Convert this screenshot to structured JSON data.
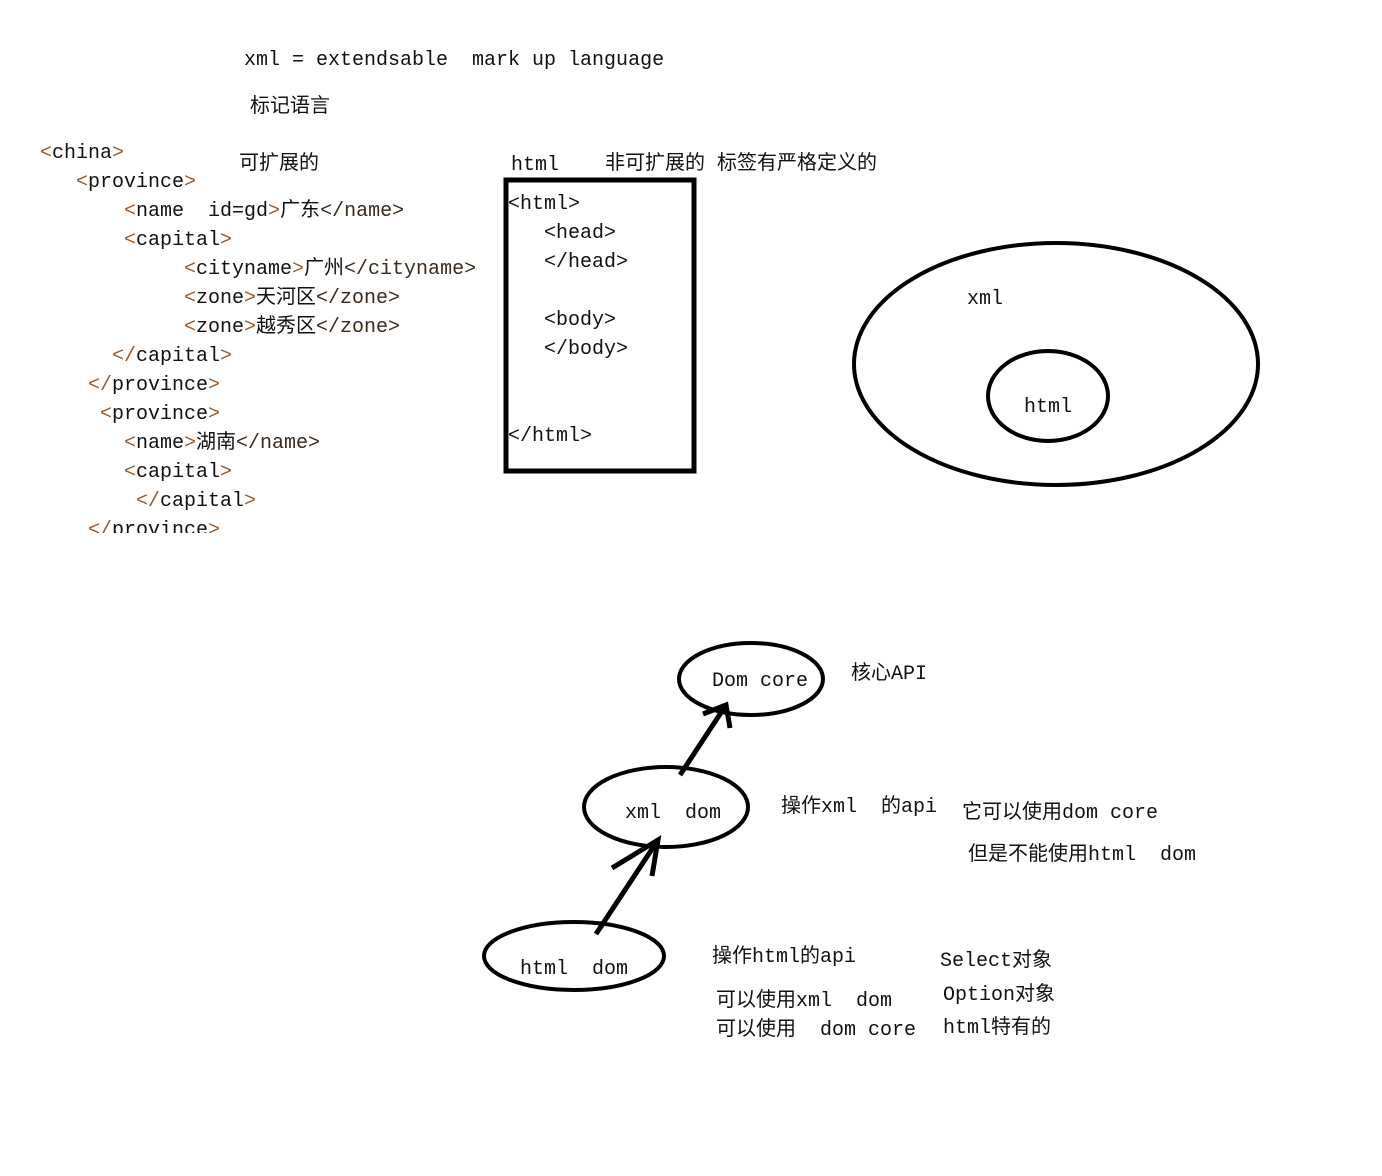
{
  "header": {
    "definition": "xml = extendsable  mark up language",
    "subtitle": "标记语言",
    "extensible": "可扩展的"
  },
  "xml_code": [
    {
      "indent": 0,
      "open": "<",
      "text": "china",
      "close": ">"
    },
    {
      "indent": 1,
      "open": "<",
      "text": "province",
      "close": ">"
    },
    {
      "indent": 2,
      "open": "<",
      "text": "name  id=gd",
      "close": ">",
      "value": "广东",
      "end": "</name>"
    },
    {
      "indent": 2,
      "open": "<",
      "text": "capital",
      "close": ">"
    },
    {
      "indent": 3,
      "open": "<",
      "text": "cityname",
      "close": ">",
      "value": "广州",
      "end": "</cityname>"
    },
    {
      "indent": 3,
      "open": "<",
      "text": "zone",
      "close": ">",
      "value": "天河区",
      "end": "</zone>"
    },
    {
      "indent": 3,
      "open": "<",
      "text": "zone",
      "close": ">",
      "value": "越秀区",
      "end": "</zone>"
    },
    {
      "indent": 1.5,
      "open": "</",
      "text": "capital",
      "close": ">"
    },
    {
      "indent": 1,
      "open": "</",
      "text": "province",
      "close": ">"
    },
    {
      "indent": 1,
      "open": "<",
      "text": "province",
      "close": ">"
    },
    {
      "indent": 2,
      "open": "<",
      "text": "name",
      "close": ">",
      "value": "湖南",
      "end": "</name>"
    },
    {
      "indent": 2,
      "open": "<",
      "text": "capital",
      "close": ">"
    },
    {
      "indent": 2,
      "open": "</",
      "text": "capital",
      "close": ">"
    },
    {
      "indent": 1,
      "open": "</",
      "text": "province",
      "close": ">"
    }
  ],
  "html_section": {
    "label": "html",
    "description": "非可扩展的 标签有严格定义的",
    "code": [
      "<html>",
      "<head>",
      "</head>",
      "<body>",
      "</body>",
      "</html>"
    ]
  },
  "venn": {
    "outer": "xml",
    "inner": "html"
  },
  "dom": {
    "core": "Dom core",
    "core_note": "核心API",
    "xml_dom": "xml  dom",
    "xml_note": "操作xml  的api",
    "xml_can": "它可以使用dom core",
    "xml_cannot": "但是不能使用html  dom",
    "html_dom": "html  dom",
    "html_note": "操作html的api",
    "html_can1": "可以使用xml  dom",
    "html_can2": "可以使用  dom core",
    "html_special1": "Select对象",
    "html_special2": "Option对象",
    "html_special3": "html特有的"
  }
}
